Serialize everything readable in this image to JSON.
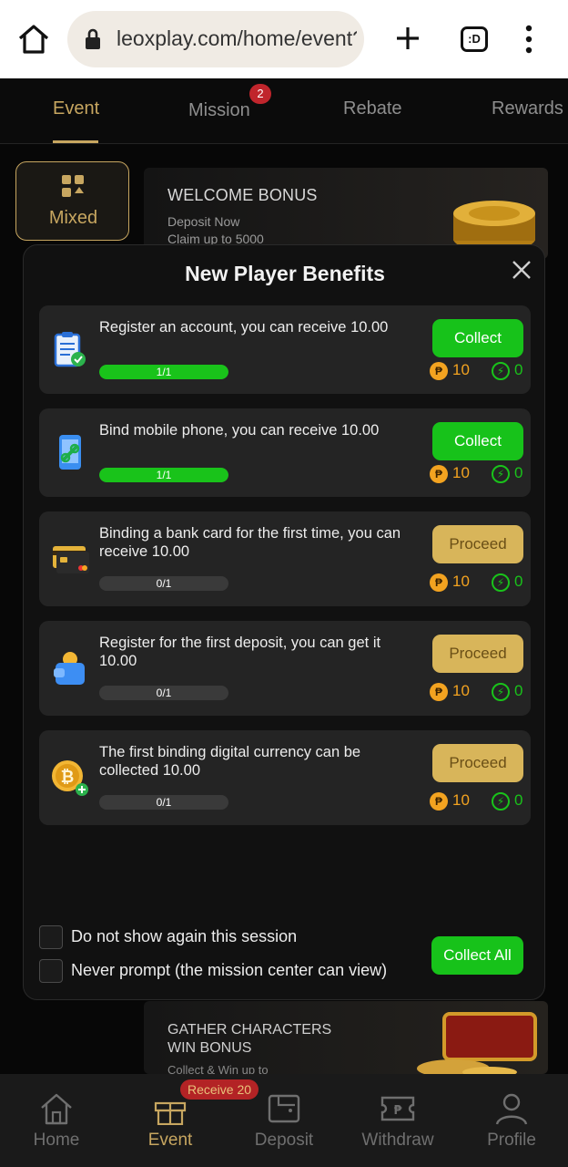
{
  "browser": {
    "url": "leoxplay.com/home/event?",
    "tabs_count_label": ":D"
  },
  "top_tabs": [
    {
      "label": "Event",
      "active": true
    },
    {
      "label": "Mission",
      "badge": "2"
    },
    {
      "label": "Rebate"
    },
    {
      "label": "Rewards"
    }
  ],
  "sidebar": {
    "mixed_label": "Mixed"
  },
  "banners": {
    "welcome_title": "WELCOME BONUS",
    "welcome_line1": "Deposit Now",
    "welcome_line2": "Claim up to 5000",
    "gather_line1": "GATHER CHARACTERS",
    "gather_line2": "WIN BONUS",
    "gather_sub": "Collect & Win up to"
  },
  "modal": {
    "title": "New Player Benefits",
    "tasks": [
      {
        "icon": "clipboard-check-icon",
        "desc": "Register an account, you can receive 10.00",
        "progress": "1/1",
        "progress_fraction": 1.0,
        "button": "Collect",
        "button_type": "collect",
        "coins": "10",
        "energy": "0"
      },
      {
        "icon": "phone-link-icon",
        "desc": "Bind mobile phone, you can receive 10.00",
        "progress": "1/1",
        "progress_fraction": 1.0,
        "button": "Collect",
        "button_type": "collect",
        "coins": "10",
        "energy": "0"
      },
      {
        "icon": "bank-card-icon",
        "desc": "Binding a bank card for the first time, you can receive 10.00",
        "progress": "0/1",
        "progress_fraction": 0.0,
        "button": "Proceed",
        "button_type": "proceed",
        "coins": "10",
        "energy": "0"
      },
      {
        "icon": "wallet-icon",
        "desc": "Register for the first deposit, you can get it 10.00",
        "progress": "0/1",
        "progress_fraction": 0.0,
        "button": "Proceed",
        "button_type": "proceed",
        "coins": "10",
        "energy": "0"
      },
      {
        "icon": "bitcoin-add-icon",
        "desc": "The first binding digital currency can be collected 10.00",
        "progress": "0/1",
        "progress_fraction": 0.0,
        "button": "Proceed",
        "button_type": "proceed",
        "coins": "10",
        "energy": "0"
      }
    ],
    "checkbox_1": "Do not show again this session",
    "checkbox_2": "Never prompt (the mission center can view)",
    "collect_all": "Collect All"
  },
  "bottom_nav": [
    {
      "label": "Home",
      "icon": "home-icon"
    },
    {
      "label": "Event",
      "icon": "gift-icon",
      "active": true
    },
    {
      "label": "Deposit",
      "icon": "wallet-icon"
    },
    {
      "label": "Withdraw",
      "icon": "ticket-icon"
    },
    {
      "label": "Profile",
      "icon": "user-icon"
    }
  ],
  "nav_badge": "Receive 20",
  "colors": {
    "gold": "#c7a660",
    "green": "#17c21a",
    "proceed": "#d8b55a",
    "coin": "#f3a320",
    "badge_red": "#c0252c"
  }
}
